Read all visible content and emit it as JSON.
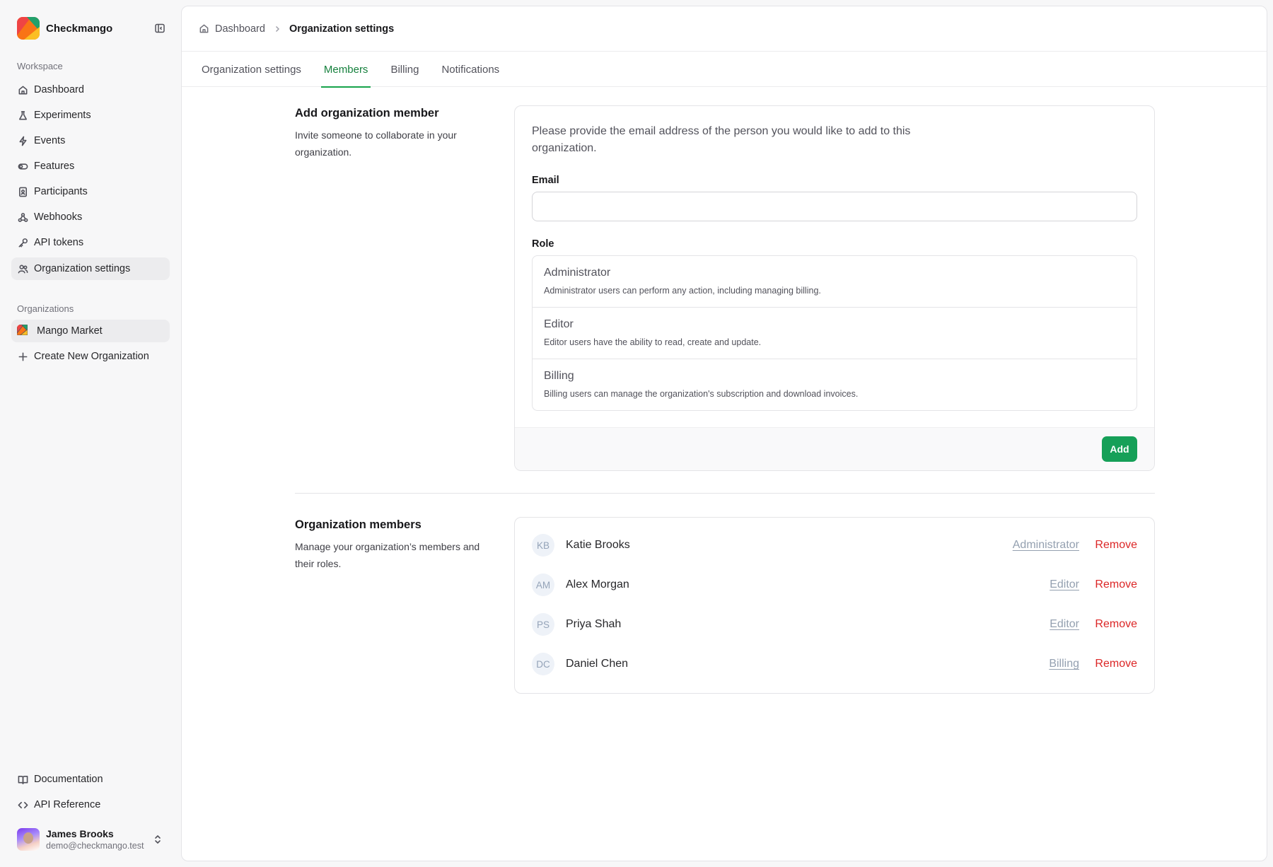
{
  "app": {
    "name": "Checkmango"
  },
  "sidebar": {
    "workspace_label": "Workspace",
    "items": [
      {
        "label": "Dashboard",
        "icon": "home-icon"
      },
      {
        "label": "Experiments",
        "icon": "flask-icon"
      },
      {
        "label": "Events",
        "icon": "bolt-icon"
      },
      {
        "label": "Features",
        "icon": "toggle-icon"
      },
      {
        "label": "Participants",
        "icon": "id-badge-icon"
      },
      {
        "label": "Webhooks",
        "icon": "webhook-icon"
      },
      {
        "label": "API tokens",
        "icon": "key-icon"
      },
      {
        "label": "Organization settings",
        "icon": "users-icon",
        "active": true
      }
    ],
    "organizations_label": "Organizations",
    "organizations": [
      {
        "label": "Mango Market",
        "active": true
      }
    ],
    "create_org_label": "Create New Organization",
    "footer_links": [
      {
        "label": "Documentation",
        "icon": "book-icon"
      },
      {
        "label": "API Reference",
        "icon": "code-icon"
      }
    ],
    "user": {
      "name": "James Brooks",
      "email": "demo@checkmango.test"
    }
  },
  "breadcrumb": {
    "root": "Dashboard",
    "current": "Organization settings"
  },
  "tabs": [
    {
      "label": "Organization settings"
    },
    {
      "label": "Members",
      "active": true
    },
    {
      "label": "Billing"
    },
    {
      "label": "Notifications"
    }
  ],
  "add_member": {
    "title": "Add organization member",
    "description": "Invite someone to collaborate in your organization.",
    "intro": "Please provide the email address of the person you would like to add to this organization.",
    "email_label": "Email",
    "email_value": "",
    "role_label": "Role",
    "roles": [
      {
        "name": "Administrator",
        "description": "Administrator users can perform any action, including managing billing."
      },
      {
        "name": "Editor",
        "description": "Editor users have the ability to read, create and update."
      },
      {
        "name": "Billing",
        "description": "Billing users can manage the organization's subscription and download invoices."
      }
    ],
    "add_button": "Add"
  },
  "members": {
    "title": "Organization members",
    "description": "Manage your organization’s members and their roles.",
    "remove_label": "Remove",
    "list": [
      {
        "initials": "KB",
        "name": "Katie Brooks",
        "role": "Administrator"
      },
      {
        "initials": "AM",
        "name": "Alex Morgan",
        "role": "Editor"
      },
      {
        "initials": "PS",
        "name": "Priya Shah",
        "role": "Editor"
      },
      {
        "initials": "DC",
        "name": "Daniel Chen",
        "role": "Billing"
      }
    ]
  },
  "colors": {
    "accent": "#16a058",
    "danger": "#dc2626",
    "tab_active": "#15803d"
  }
}
